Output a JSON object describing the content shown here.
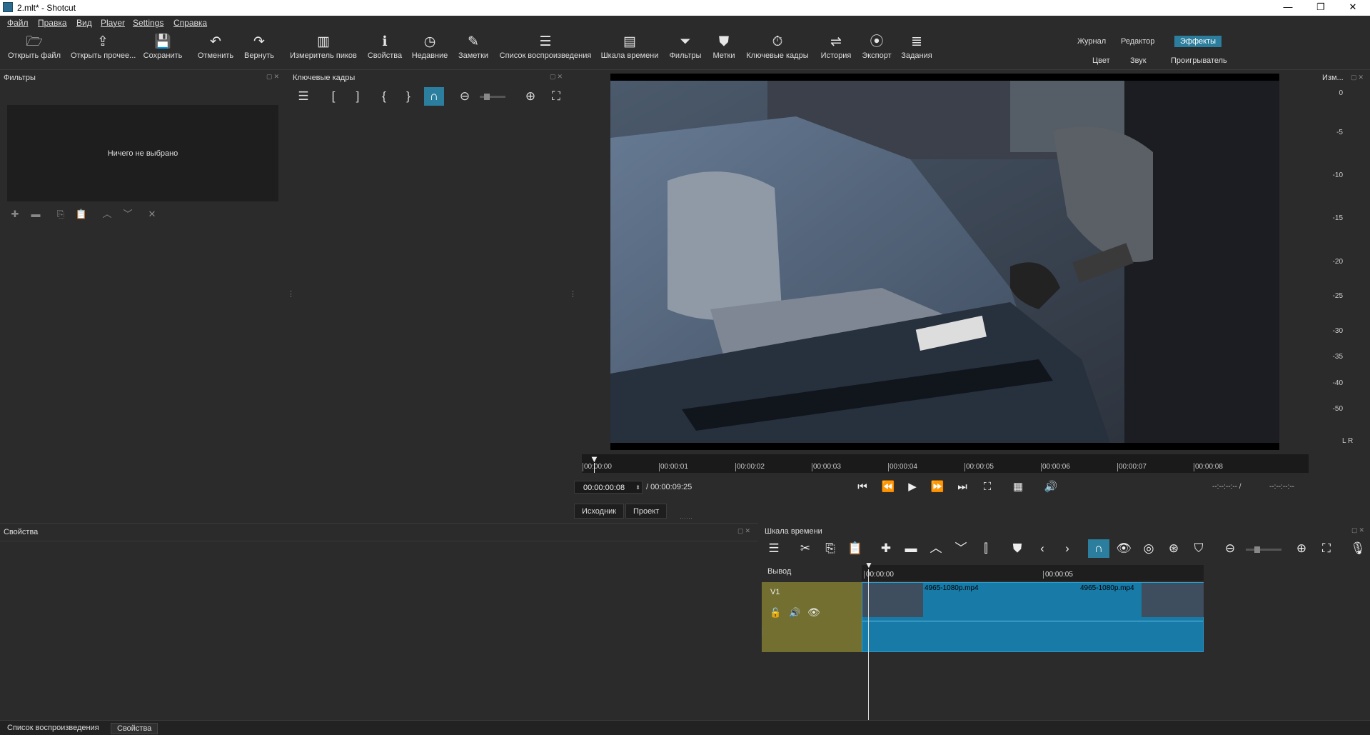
{
  "window": {
    "title": "2.mlt* - Shotcut",
    "minimize": "—",
    "maximize": "❐",
    "close": "✕"
  },
  "menu": [
    "Файл",
    "Правка",
    "Вид",
    "Player",
    "Settings",
    "Справка"
  ],
  "toolbar": [
    {
      "label": "Открыть файл",
      "icon": "folder-open-icon",
      "glyph": "🗁"
    },
    {
      "label": "Открыть прочее...",
      "icon": "open-other-icon",
      "glyph": "⇪"
    },
    {
      "label": "Сохранить",
      "icon": "save-icon",
      "glyph": "💾"
    },
    {
      "label": "Отменить",
      "icon": "undo-icon",
      "glyph": "↶"
    },
    {
      "label": "Вернуть",
      "icon": "redo-icon",
      "glyph": "↷"
    },
    {
      "label": "Измеритель пиков",
      "icon": "peak-meter-icon",
      "glyph": "▥"
    },
    {
      "label": "Свойства",
      "icon": "info-icon",
      "glyph": "ℹ"
    },
    {
      "label": "Недавние",
      "icon": "clock-icon",
      "glyph": "◷"
    },
    {
      "label": "Заметки",
      "icon": "notes-icon",
      "glyph": "✎"
    },
    {
      "label": "Список воспроизведения",
      "icon": "playlist-icon",
      "glyph": "☰"
    },
    {
      "label": "Шкала времени",
      "icon": "timeline-icon",
      "glyph": "▤"
    },
    {
      "label": "Фильтры",
      "icon": "filter-icon",
      "glyph": "⏷"
    },
    {
      "label": "Метки",
      "icon": "marker-icon",
      "glyph": "⛊"
    },
    {
      "label": "Ключевые кадры",
      "icon": "stopwatch-icon",
      "glyph": "⏱"
    },
    {
      "label": "История",
      "icon": "history-icon",
      "glyph": "⇌"
    },
    {
      "label": "Экспорт",
      "icon": "export-icon",
      "glyph": "⦿"
    },
    {
      "label": "Задания",
      "icon": "jobs-icon",
      "glyph": "≣"
    }
  ],
  "layouts": {
    "top": [
      "Журнал",
      "Редактор",
      "Эффекты"
    ],
    "bottom": [
      "Цвет",
      "Звук",
      "Проигрыватель"
    ],
    "active": "Эффекты"
  },
  "filters": {
    "title": "Фильтры",
    "empty": "Ничего не выбрано"
  },
  "keyframes": {
    "title": "Ключевые кадры"
  },
  "meter": {
    "title": "Изм...",
    "labels": [
      "0",
      "-5",
      "-10",
      "-15",
      "-20",
      "-25",
      "-30",
      "-35",
      "-40",
      "-50"
    ],
    "lr": "L R"
  },
  "player": {
    "ticks": [
      "00:00:00",
      "00:00:01",
      "00:00:02",
      "00:00:03",
      "00:00:04",
      "00:00:05",
      "00:00:06",
      "00:00:07",
      "00:00:08"
    ],
    "position": "00:00:00:08",
    "duration": "/ 00:00:09:25",
    "in_out_a": "--:--:--:-- /",
    "in_out_b": "--:--:--:--",
    "source_tab": "Исходник",
    "project_tab": "Проект"
  },
  "properties": {
    "title": "Свойства"
  },
  "timeline": {
    "title": "Шкала времени",
    "output_label": "Вывод",
    "track": "V1",
    "ticks": [
      "00:00:00",
      "00:00:05"
    ],
    "clips": [
      "4965-1080p.mp4",
      "4965-1080p.mp4"
    ]
  },
  "bottom_tabs": [
    "Список воспроизведения",
    "Свойства"
  ]
}
